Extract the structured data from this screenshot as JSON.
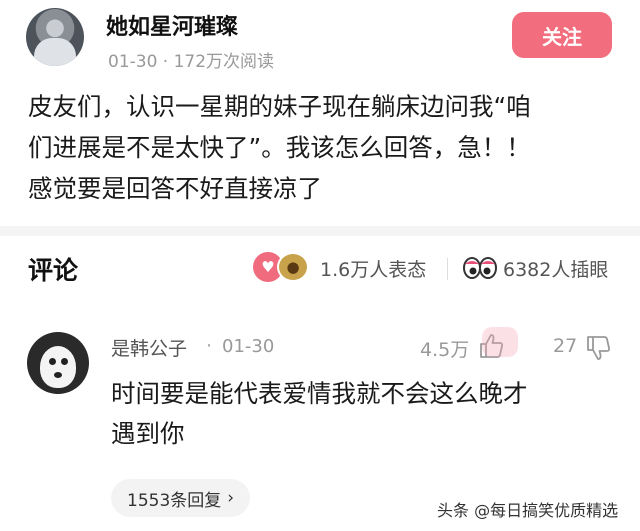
{
  "post": {
    "author_name": "她如星河璀璨",
    "meta": "01-30 · 172万次阅读",
    "follow_label": "关注",
    "body_lines": [
      "皮友们，认识一星期的妹子现在躺床边问我“咱",
      "们进展是不是太快了”。我该怎么回答，急！！",
      "感觉要是回答不好直接凉了"
    ]
  },
  "comments_header": {
    "title": "评论",
    "reactions_label": "1.6万人表态",
    "eyes_label": "6382人插眼",
    "reaction_like_icon": "like-icon",
    "reaction_cat_icon": "cat-emoji-icon"
  },
  "comment": {
    "author": "是韩公子",
    "dot": "·",
    "date": "01-30",
    "likes": "4.5万",
    "dislikes": "27",
    "text_lines": [
      "时间要是能代表爱情我就不会这么晚才",
      "遇到你"
    ],
    "replies_label": "1553条回复",
    "replies_chevron": "›"
  },
  "watermark": "头条 @每日搞笑优质精选",
  "colors": {
    "follow_bg": "#f26d7d",
    "divider": "#f4f4f4"
  }
}
